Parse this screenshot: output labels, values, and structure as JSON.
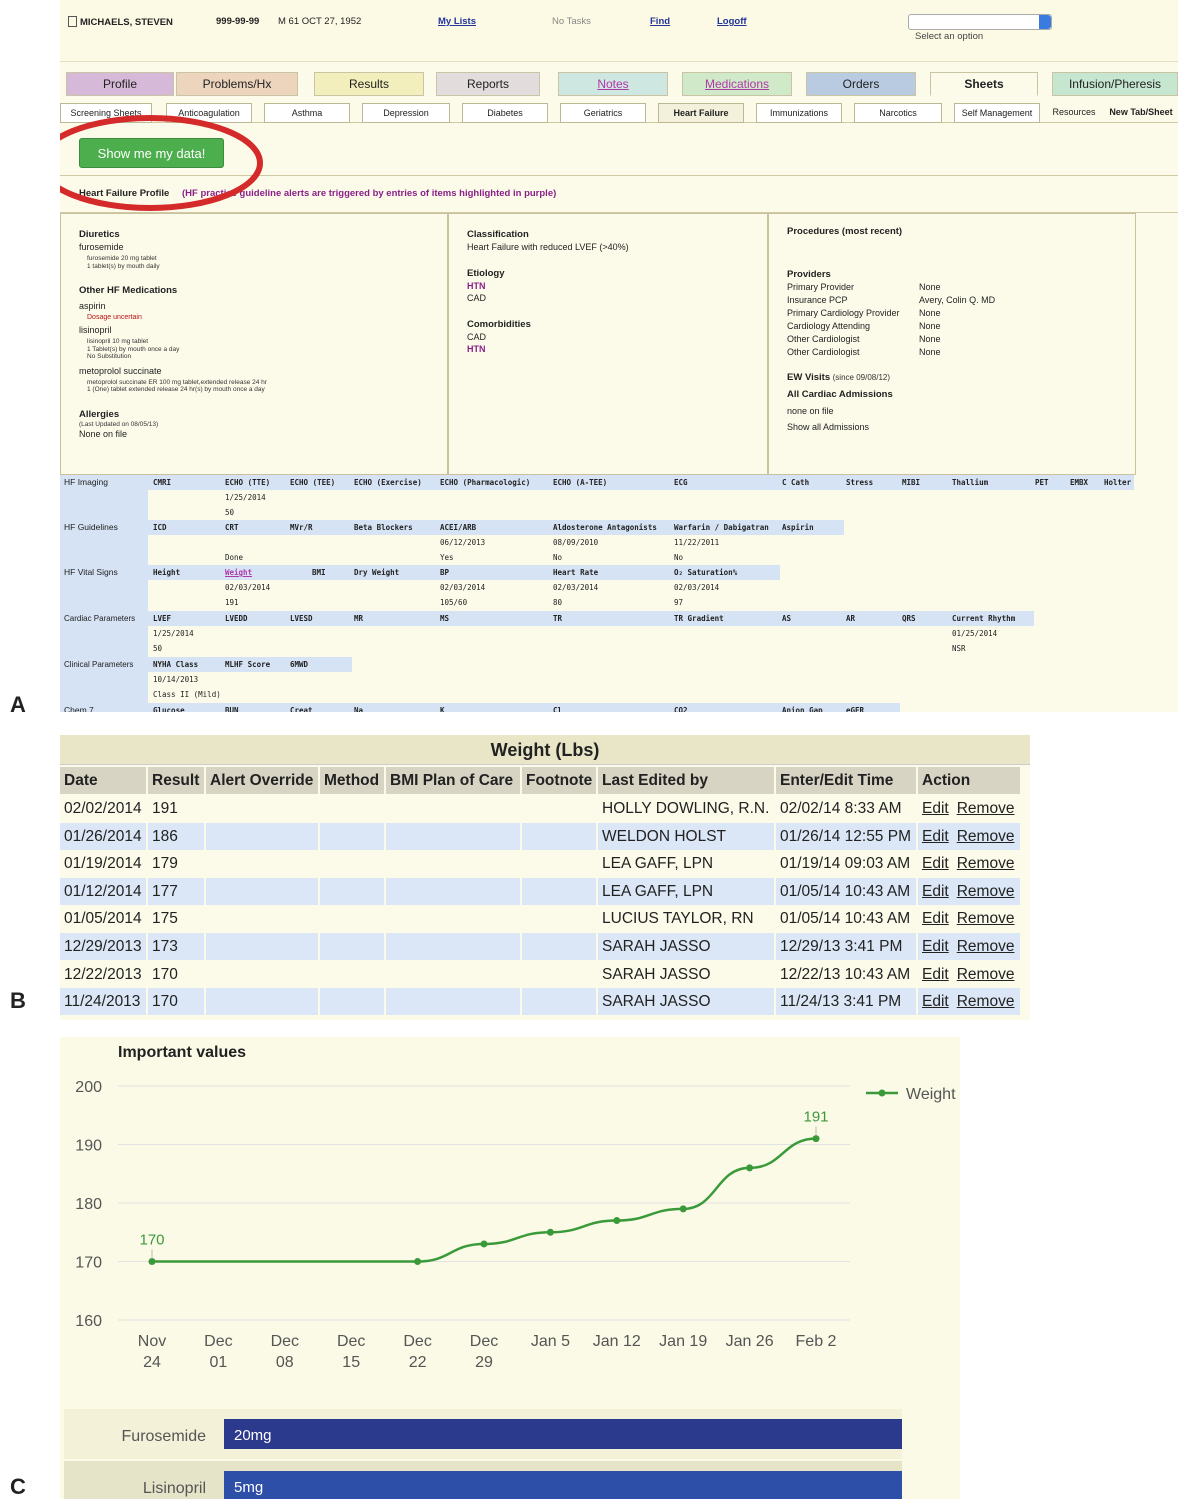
{
  "panel_labels": {
    "a": "A",
    "b": "B",
    "c": "C"
  },
  "header": {
    "patient_name": "MICHAELS, STEVEN",
    "mrn": "999-99-99",
    "demographics": "M 61  OCT 27, 1952",
    "my_lists": "My Lists",
    "no_tasks": "No Tasks",
    "find": "Find",
    "logoff": "Logoff",
    "select_placeholder": "Select an option"
  },
  "tabs": [
    "Profile",
    "Problems/Hx",
    "Results",
    "Reports",
    "Notes",
    "Medications",
    "Orders",
    "Sheets",
    "Infusion/Pheresis"
  ],
  "subtabs": [
    "Screening Sheets",
    "Anticoagulation",
    "Asthma",
    "Depression",
    "Diabetes",
    "Geriatrics",
    "Heart Failure",
    "Immunizations",
    "Narcotics",
    "Self Management",
    "Resources",
    "New Tab/Sheet"
  ],
  "show_button": "Show me my data!",
  "hf_profile": {
    "title": "Heart Failure Profile",
    "note": "(HF practice guideline alerts are triggered by entries of items highlighted in purple)"
  },
  "meds_box": {
    "diuretics": "Diuretics",
    "furosemide": "furosemide",
    "furosemide_detail_1": "furosemide 20 mg tablet",
    "furosemide_detail_2": "1 tablet(s) by mouth daily",
    "other": "Other HF Medications",
    "aspirin": "aspirin",
    "dosage": "Dosage uncertain",
    "lisinopril": "lisinopril",
    "lisinopril_detail_1": "lisinopril 10 mg tablet",
    "lisinopril_detail_2": "1 Tablet(s) by mouth once a day",
    "lisinopril_detail_3": "No Substitution",
    "metoprolol": "metoprolol succinate",
    "metoprolol_detail_1": "metoprolol succinate ER 100 mg tablet,extended release 24 hr",
    "metoprolol_detail_2": "1 (One) tablet extended release 24 hr(s) by mouth once a day",
    "allergies": "Allergies",
    "allergies_updated": "(Last Updated on 08/05/13)",
    "allergies_value": "None on file"
  },
  "class_box": {
    "classification": "Classification",
    "classification_value": "Heart Failure with reduced LVEF (>40%)",
    "etiology": "Etiology",
    "etiology_1": "HTN",
    "etiology_2": "CAD",
    "comorbidities": "Comorbidities",
    "comorbid_1": "CAD",
    "comorbid_2": "HTN"
  },
  "proc_box": {
    "procedures": "Procedures (most recent)",
    "providers": "Providers",
    "rows": [
      {
        "k": "Primary Provider",
        "v": "None"
      },
      {
        "k": "Insurance PCP",
        "v": "Avery, Colin Q. MD"
      },
      {
        "k": "Primary Cardiology Provider",
        "v": "None"
      },
      {
        "k": "Cardiology Attending",
        "v": "None"
      },
      {
        "k": "Other Cardiologist",
        "v": "None"
      },
      {
        "k": "Other Cardiologist",
        "v": "None"
      }
    ],
    "ew_visits": "EW Visits",
    "ew_since": "(since 09/08/12)",
    "cardiac": "All Cardiac Admissions",
    "none_on_file": "none on file",
    "show_all": "Show all Admissions"
  },
  "grid": {
    "imaging_label": "HF Imaging",
    "imaging_cols": [
      "CMRI",
      "ECHO (TTE)",
      "ECHO (TEE)",
      "ECHO (Exercise)",
      "ECHO (Pharmacologic)",
      "ECHO (A-TEE)",
      "ECG",
      "C Cath",
      "Stress",
      "MIBI",
      "Thallium",
      "PET",
      "EMBX",
      "Holter"
    ],
    "imaging_date": "1/25/2014",
    "imaging_val": "50",
    "guidelines_label": "HF Guidelines",
    "guidelines_cols": [
      "ICD",
      "CRT",
      "MVr/R",
      "Beta Blockers",
      "ACEI/ARB",
      "Aldosterone Antagonists",
      "Warfarin / Dabigatran",
      "Aspirin"
    ],
    "g_acei_date": "06/12/2013",
    "g_aldo_date": "08/09/2010",
    "g_warf_date": "11/22/2011",
    "g_crt_val": "Done",
    "g_acei_val": "Yes",
    "g_aldo_val": "No",
    "g_warf_val": "No",
    "vital_label": "HF Vital Signs",
    "vital_cols": [
      "Height",
      "Weight",
      "BMI",
      "Dry Weight",
      "BP",
      "Heart Rate",
      "O₂ Saturation%"
    ],
    "v_date": "02/03/2014",
    "v_weight": "191",
    "v_bp": "105/60",
    "v_hr": "80",
    "v_o2": "97",
    "cardiac_label": "Cardiac Parameters",
    "cardiac_cols": [
      "LVEF",
      "LVEDD",
      "LVESD",
      "MR",
      "MS",
      "TR",
      "TR Gradient",
      "AS",
      "AR",
      "QRS",
      "Current Rhythm"
    ],
    "c_date": "1/25/2014",
    "c_val": "50",
    "c_rhythm_date": "01/25/2014",
    "c_rhythm": "NSR",
    "clinical_label": "Clinical Parameters",
    "clinical_cols": [
      "NYHA Class",
      "MLHF Score",
      "6MWD"
    ],
    "cl_date": "10/14/2013",
    "cl_val": "Class II (Mild)",
    "chem_label": "Chem 7",
    "chem_cols": [
      "Glucose",
      "BUN",
      "Creat",
      "Na",
      "K",
      "Cl",
      "CO2",
      "Anion Gap",
      "eGFR"
    ]
  },
  "weight_table": {
    "title": "Weight (Lbs)",
    "columns": [
      "Date",
      "Result",
      "Alert Override",
      "Method",
      "BMI Plan of Care",
      "Footnote",
      "Last Edited by",
      "Enter/Edit Time",
      "Action"
    ],
    "edit": "Edit",
    "remove": "Remove",
    "rows": [
      {
        "date": "02/02/2014",
        "result": "191",
        "by": "HOLLY DOWLING, R.N.",
        "time": "02/02/14 8:33 AM"
      },
      {
        "date": "01/26/2014",
        "result": "186",
        "by": "WELDON HOLST",
        "time": "01/26/14 12:55 PM"
      },
      {
        "date": "01/19/2014",
        "result": "179",
        "by": "LEA GAFF, LPN",
        "time": "01/19/14 09:03 AM"
      },
      {
        "date": "01/12/2014",
        "result": "177",
        "by": "LEA GAFF, LPN",
        "time": "01/05/14 10:43 AM"
      },
      {
        "date": "01/05/2014",
        "result": "175",
        "by": "LUCIUS TAYLOR, RN",
        "time": "01/05/14 10:43 AM"
      },
      {
        "date": "12/29/2013",
        "result": "173",
        "by": "SARAH JASSO",
        "time": "12/29/13 3:41 PM"
      },
      {
        "date": "12/22/2013",
        "result": "170",
        "by": "SARAH JASSO",
        "time": "12/22/13 10:43 AM"
      },
      {
        "date": "11/24/2013",
        "result": "170",
        "by": "SARAH JASSO",
        "time": "11/24/13 3:41 PM"
      }
    ]
  },
  "chart_data": {
    "type": "line",
    "title": "Important values",
    "x": [
      "Nov 24",
      "Dec 01",
      "Dec 08",
      "Dec 15",
      "Dec 22",
      "Dec 29",
      "Jan 5",
      "Jan 12",
      "Jan 19",
      "Jan 26",
      "Feb 2"
    ],
    "series": [
      {
        "name": "Weight",
        "color": "#3a9a3a",
        "values": [
          170,
          null,
          null,
          null,
          170,
          173,
          175,
          177,
          179,
          186,
          191
        ]
      }
    ],
    "ylim": [
      160,
      200
    ],
    "yticks": [
      160,
      170,
      180,
      190,
      200
    ],
    "annotations": [
      {
        "x": "Nov 24",
        "label": "170"
      },
      {
        "x": "Feb 2",
        "label": "191"
      }
    ],
    "grid": true,
    "legend": "top-right"
  },
  "med_bars": [
    {
      "name": "Furosemide",
      "dose": "20mg",
      "color": "#2b3a8c"
    },
    {
      "name": "Lisinopril",
      "dose": "5mg",
      "color": "#2e4fa8"
    }
  ]
}
